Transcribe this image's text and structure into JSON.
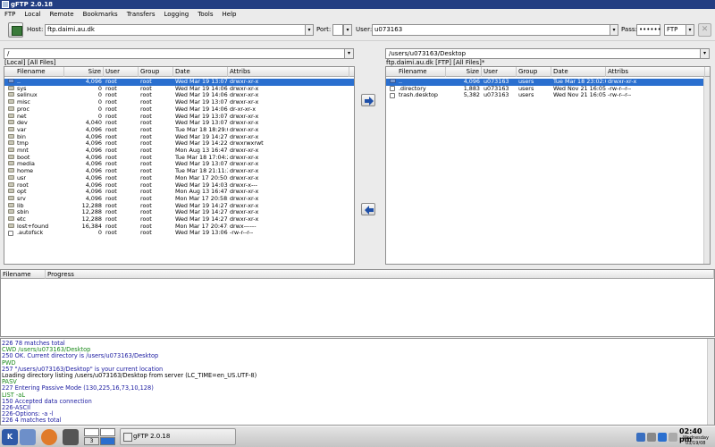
{
  "window": {
    "title": "gFTP 2.0.18"
  },
  "menu": [
    "FTP",
    "Local",
    "Remote",
    "Bookmarks",
    "Transfers",
    "Logging",
    "Tools",
    "Help"
  ],
  "toolbar": {
    "host_label": "Host:",
    "host_value": "ftp.daimi.au.dk",
    "port_label": "Port:",
    "port_value": "",
    "user_label": "User:",
    "user_value": "u073163",
    "pass_label": "Pass:",
    "pass_value": "••••••",
    "protocol": "FTP"
  },
  "columns": {
    "filename": "Filename",
    "size": "Size",
    "user": "User",
    "group": "Group",
    "date": "Date",
    "attribs": "Attribs"
  },
  "local": {
    "path": "/",
    "status": "[Local] [All Files]",
    "rows": [
      {
        "icon": "up-folder-icon",
        "name": "..",
        "size": "4,096",
        "user": "root",
        "group": "root",
        "date": "Wed Mar 19 13:07:0",
        "attribs": "drwxr-xr-x"
      },
      {
        "icon": "folder-icon",
        "name": "sys",
        "size": "0",
        "user": "root",
        "group": "root",
        "date": "Wed Mar 19 14:06:3",
        "attribs": "drwxr-xr-x"
      },
      {
        "icon": "folder-icon",
        "name": "selinux",
        "size": "0",
        "user": "root",
        "group": "root",
        "date": "Wed Mar 19 14:06:3",
        "attribs": "drwxr-xr-x"
      },
      {
        "icon": "folder-icon",
        "name": "misc",
        "size": "0",
        "user": "root",
        "group": "root",
        "date": "Wed Mar 19 13:07:0",
        "attribs": "drwxr-xr-x"
      },
      {
        "icon": "folder-icon",
        "name": "proc",
        "size": "0",
        "user": "root",
        "group": "root",
        "date": "Wed Mar 19 14:06:3",
        "attribs": "dr-xr-xr-x"
      },
      {
        "icon": "folder-icon",
        "name": "net",
        "size": "0",
        "user": "root",
        "group": "root",
        "date": "Wed Mar 19 13:07:0",
        "attribs": "drwxr-xr-x"
      },
      {
        "icon": "folder-icon",
        "name": "dev",
        "size": "4,040",
        "user": "root",
        "group": "root",
        "date": "Wed Mar 19 13:07:3",
        "attribs": "drwxr-xr-x"
      },
      {
        "icon": "folder-icon",
        "name": "var",
        "size": "4,096",
        "user": "root",
        "group": "root",
        "date": "Tue Mar 18 18:29:0",
        "attribs": "drwxr-xr-x"
      },
      {
        "icon": "folder-icon",
        "name": "bin",
        "size": "4,096",
        "user": "root",
        "group": "root",
        "date": "Wed Mar 19 14:27:3",
        "attribs": "drwxr-xr-x"
      },
      {
        "icon": "folder-icon",
        "name": "tmp",
        "size": "4,096",
        "user": "root",
        "group": "root",
        "date": "Wed Mar 19 14:22:3",
        "attribs": "drwxrwxrwt"
      },
      {
        "icon": "folder-icon",
        "name": "mnt",
        "size": "4,096",
        "user": "root",
        "group": "root",
        "date": "Mon Aug 13 16:47:5",
        "attribs": "drwxr-xr-x"
      },
      {
        "icon": "folder-icon",
        "name": "boot",
        "size": "4,096",
        "user": "root",
        "group": "root",
        "date": "Tue Mar 18 17:04:2",
        "attribs": "drwxr-xr-x"
      },
      {
        "icon": "folder-icon",
        "name": "media",
        "size": "4,096",
        "user": "root",
        "group": "root",
        "date": "Wed Mar 19 13:07:3",
        "attribs": "drwxr-xr-x"
      },
      {
        "icon": "folder-icon",
        "name": "home",
        "size": "4,096",
        "user": "root",
        "group": "root",
        "date": "Tue Mar 18 21:11:3",
        "attribs": "drwxr-xr-x"
      },
      {
        "icon": "folder-icon",
        "name": "usr",
        "size": "4,096",
        "user": "root",
        "group": "root",
        "date": "Mon Mar 17 20:50:5",
        "attribs": "drwxr-xr-x"
      },
      {
        "icon": "folder-icon",
        "name": "root",
        "size": "4,096",
        "user": "root",
        "group": "root",
        "date": "Wed Mar 19 14:03:3",
        "attribs": "drwxr-x---"
      },
      {
        "icon": "folder-icon",
        "name": "opt",
        "size": "4,096",
        "user": "root",
        "group": "root",
        "date": "Mon Aug 13 16:47:5",
        "attribs": "drwxr-xr-x"
      },
      {
        "icon": "folder-icon",
        "name": "srv",
        "size": "4,096",
        "user": "root",
        "group": "root",
        "date": "Mon Mar 17 20:58:0",
        "attribs": "drwxr-xr-x"
      },
      {
        "icon": "folder-icon",
        "name": "lib",
        "size": "12,288",
        "user": "root",
        "group": "root",
        "date": "Wed Mar 19 14:27:5",
        "attribs": "drwxr-xr-x"
      },
      {
        "icon": "folder-icon",
        "name": "sbin",
        "size": "12,288",
        "user": "root",
        "group": "root",
        "date": "Wed Mar 19 14:27:5",
        "attribs": "drwxr-xr-x"
      },
      {
        "icon": "folder-icon",
        "name": "etc",
        "size": "12,288",
        "user": "root",
        "group": "root",
        "date": "Wed Mar 19 14:27:5",
        "attribs": "drwxr-xr-x"
      },
      {
        "icon": "folder-icon",
        "name": "lost+found",
        "size": "16,384",
        "user": "root",
        "group": "root",
        "date": "Mon Mar 17 20:47:3",
        "attribs": "drwx------"
      },
      {
        "icon": "file-icon",
        "name": ".autofsck",
        "size": "0",
        "user": "root",
        "group": "root",
        "date": "Wed Mar 19 13:06:5",
        "attribs": "-rw-r--r--"
      }
    ]
  },
  "remote": {
    "path": "/users/u073163/Desktop",
    "status": "ftp.daimi.au.dk [FTP] [All Files]*",
    "rows": [
      {
        "icon": "up-folder-icon",
        "name": "..",
        "size": "4,096",
        "user": "u073163",
        "group": "users",
        "date": "Tue Mar 18 23:02:0",
        "attribs": "drwxr-xr-x"
      },
      {
        "icon": "file-icon",
        "name": ".directory",
        "size": "1,883",
        "user": "u073163",
        "group": "users",
        "date": "Wed Nov 21 16:05:0",
        "attribs": "-rw-r--r--"
      },
      {
        "icon": "file-icon",
        "name": "trash.desktop",
        "size": "5,382",
        "user": "u073163",
        "group": "users",
        "date": "Wed Nov 21 16:05:0",
        "attribs": "-rw-r--r--"
      }
    ]
  },
  "transfer": {
    "col_filename": "Filename",
    "col_progress": "Progress"
  },
  "log": [
    {
      "text": "226 78 matches total",
      "color": "#1a1aa0"
    },
    {
      "text": "CWD /users/u073163/Desktop",
      "color": "#1a8a1a"
    },
    {
      "text": "250 OK. Current directory is /users/u073163/Desktop",
      "color": "#1a1aa0"
    },
    {
      "text": "PWD",
      "color": "#1a8a1a"
    },
    {
      "text": "257 \"/users/u073163/Desktop\" is your current location",
      "color": "#1a1aa0"
    },
    {
      "text": "Loading directory listing /users/u073163/Desktop from server (LC_TIME=en_US.UTF-8)",
      "color": "#000000"
    },
    {
      "text": "PASV",
      "color": "#1a8a1a"
    },
    {
      "text": "227 Entering Passive Mode (130,225,16,73,10,128)",
      "color": "#1a1aa0"
    },
    {
      "text": "LIST -aL",
      "color": "#1a8a1a"
    },
    {
      "text": "150 Accepted data connection",
      "color": "#1a1aa0"
    },
    {
      "text": "226-ASCII",
      "color": "#1a1aa0"
    },
    {
      "text": "226-Options: -a -l",
      "color": "#1a1aa0"
    },
    {
      "text": "226 4 matches total",
      "color": "#1a1aa0"
    }
  ],
  "taskbar": {
    "pager_active": "3",
    "task_title": "gFTP 2.0.18",
    "clock_time": "02:40 pm",
    "clock_day": "Wednesday",
    "clock_date": "03/19/08"
  },
  "colors": {
    "selection": "#2a6fcf",
    "titlebar": "#233e82"
  }
}
